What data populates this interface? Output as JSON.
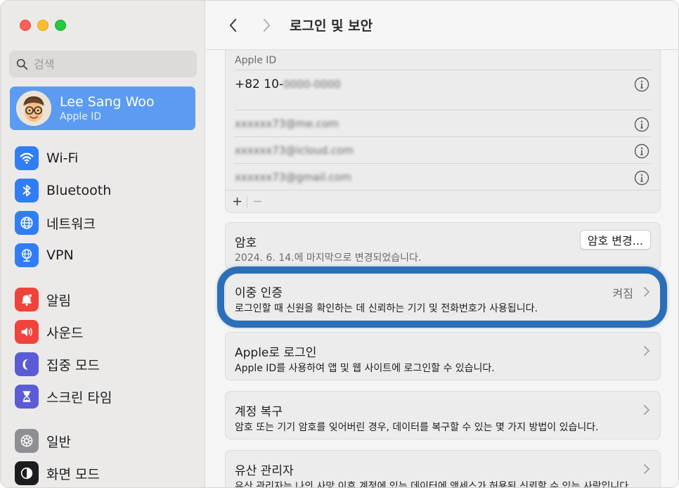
{
  "window": {
    "colors": {
      "red": "#fe5f57",
      "yellow": "#febc2e",
      "green": "#28c840",
      "accent": "#5b9cf2",
      "highlight": "#2b6fb8"
    }
  },
  "sidebar": {
    "search_placeholder": "검색",
    "profile": {
      "name": "Lee Sang Woo",
      "subtitle": "Apple ID"
    },
    "items": [
      {
        "label": "Wi-Fi",
        "icon": "wifi-icon",
        "color": "#2f7ef6"
      },
      {
        "label": "Bluetooth",
        "icon": "bluetooth-icon",
        "color": "#2f7ef6"
      },
      {
        "label": "네트워크",
        "icon": "globe-icon",
        "color": "#2f7ef6"
      },
      {
        "label": "VPN",
        "icon": "vpn-globe-icon",
        "color": "#2f7ef6"
      },
      {
        "label": "알림",
        "icon": "bell-icon",
        "color": "#f0433b"
      },
      {
        "label": "사운드",
        "icon": "speaker-icon",
        "color": "#f0433b"
      },
      {
        "label": "집중 모드",
        "icon": "moon-icon",
        "color": "#5b5bd6"
      },
      {
        "label": "스크린 타임",
        "icon": "hourglass-icon",
        "color": "#5b5bd6"
      },
      {
        "label": "일반",
        "icon": "gear-icon",
        "color": "#8e8e93"
      },
      {
        "label": "화면 모드",
        "icon": "appearance-icon",
        "color": "#1d1d1f"
      }
    ]
  },
  "toolbar": {
    "title": "로그인 및 보안"
  },
  "apple_id": {
    "label": "Apple ID",
    "phone": "+82 10-",
    "phone_hidden": "0000-0000",
    "emails": [
      "xxxxxx73@me.com",
      "xxxxxx73@icloud.com",
      "xxxxxx73@gmail.com"
    ]
  },
  "password": {
    "title": "암호",
    "desc": "2024. 6. 14.에 마지막으로 변경되었습니다.",
    "button": "암호 변경..."
  },
  "two_factor": {
    "title": "이중 인증",
    "status": "켜짐",
    "desc": "로그인할 때 신원을 확인하는 데 신뢰하는 기기 및 전화번호가 사용됩니다."
  },
  "sign_in_with_apple": {
    "title": "Apple로 로그인",
    "desc": "Apple ID를 사용하여 앱 및 웹 사이트에 로그인할 수 있습니다."
  },
  "account_recovery": {
    "title": "계정 복구",
    "desc": "암호 또는 기기 암호를 잊어버린 경우, 데이터를 복구할 수 있는 몇 가지 방법이 있습니다."
  },
  "legacy_contact": {
    "title": "유산 관리자",
    "desc": "유산 관리자는 나의 사망 이후 계정에 있는 데이터에 액세스가 허용된 신뢰할 수 있는 사람입니다."
  }
}
